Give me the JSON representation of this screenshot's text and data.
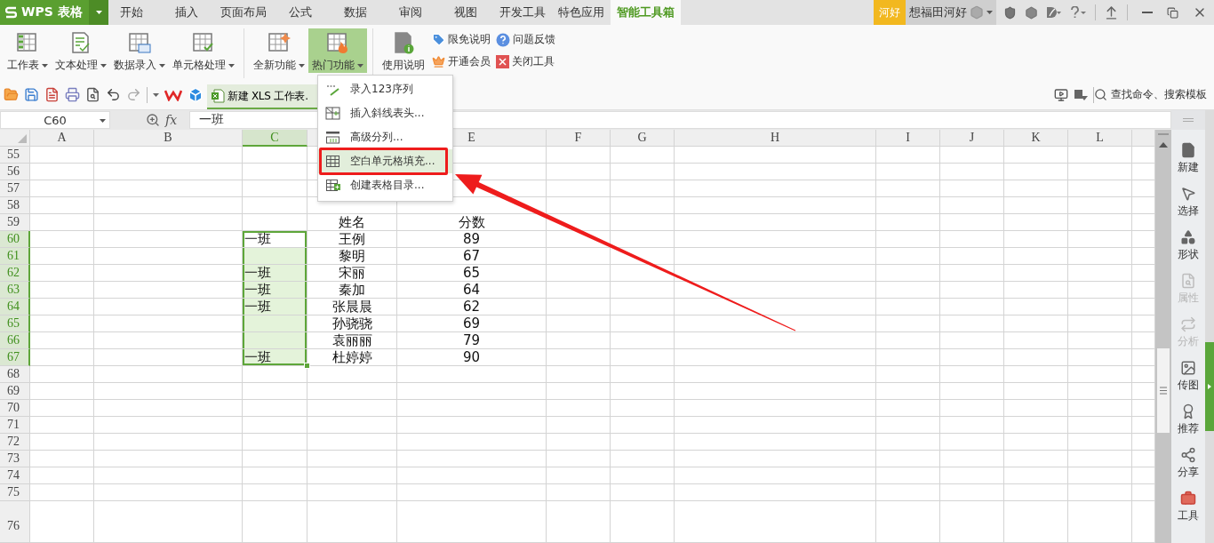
{
  "app": {
    "logo": "WPS 表格"
  },
  "tabs": [
    {
      "label": "开始",
      "selected": false
    },
    {
      "label": "插入",
      "selected": false
    },
    {
      "label": "页面布局",
      "selected": false
    },
    {
      "label": "公式",
      "selected": false
    },
    {
      "label": "数据",
      "selected": false
    },
    {
      "label": "审阅",
      "selected": false
    },
    {
      "label": "视图",
      "selected": false
    },
    {
      "label": "开发工具",
      "selected": false
    },
    {
      "label": "特色应用",
      "selected": false
    },
    {
      "label": "智能工具箱",
      "selected": true
    }
  ],
  "account": {
    "badge": "河好",
    "user": "想福田河好"
  },
  "ribbon": {
    "large_buttons": [
      {
        "label": "工作表",
        "dropdown": true,
        "selected": false
      },
      {
        "label": "文本处理",
        "dropdown": true,
        "selected": false
      },
      {
        "label": "数据录入",
        "dropdown": true,
        "selected": false
      },
      {
        "label": "单元格处理",
        "dropdown": true,
        "selected": false
      },
      {
        "label": "全新功能",
        "dropdown": true,
        "selected": false
      },
      {
        "label": "热门功能",
        "dropdown": true,
        "selected": true
      },
      {
        "label": "使用说明",
        "dropdown": false,
        "selected": false
      }
    ],
    "small_buttons": [
      {
        "label": "限免说明"
      },
      {
        "label": "问题反馈"
      },
      {
        "label": "开通会员"
      },
      {
        "label": "关闭工具"
      }
    ]
  },
  "quick_access": {
    "document_tab": "新建 XLS 工作表.",
    "search": "查找命令、搜索模板"
  },
  "formula_bar": {
    "cell_ref": "C60",
    "function_label": "fx",
    "value": "一班"
  },
  "menu": {
    "items": [
      {
        "label": "录入123序列",
        "selected": false
      },
      {
        "label": "插入斜线表头...",
        "selected": false
      },
      {
        "label": "高级分列...",
        "selected": false
      },
      {
        "label": "空白单元格填充...",
        "selected": true
      },
      {
        "label": "创建表格目录...",
        "selected": false
      }
    ]
  },
  "sheet": {
    "columns": [
      {
        "label": "A",
        "selected": false
      },
      {
        "label": "B",
        "selected": false
      },
      {
        "label": "C",
        "selected": true
      },
      {
        "selected": false
      },
      {
        "label": "E",
        "selected": false
      },
      {
        "label": "F",
        "selected": false
      },
      {
        "label": "G",
        "selected": false
      },
      {
        "label": "H",
        "selected": false
      },
      {
        "label": "I",
        "selected": false
      },
      {
        "label": "J",
        "selected": false
      },
      {
        "label": "K",
        "selected": false
      },
      {
        "label": "L",
        "selected": false
      }
    ],
    "rows": [
      {
        "number": "55",
        "selected": false
      },
      {
        "number": "56",
        "selected": false
      },
      {
        "number": "57",
        "selected": false
      },
      {
        "number": "58",
        "selected": false
      },
      {
        "number": "59",
        "selected": false,
        "column_d": "姓名",
        "column_e": "分数"
      },
      {
        "number": "60",
        "selected": true,
        "column_c": "一班",
        "column_d": "王例",
        "column_e": "89"
      },
      {
        "number": "61",
        "selected": true,
        "column_d": "黎明",
        "column_e": "67"
      },
      {
        "number": "62",
        "selected": true,
        "column_c": "一班",
        "column_d": "宋丽",
        "column_e": "65"
      },
      {
        "number": "63",
        "selected": true,
        "column_c": "一班",
        "column_d": "秦加",
        "column_e": "64"
      },
      {
        "number": "64",
        "selected": true,
        "column_c": "一班",
        "column_d": "张晨晨",
        "column_e": "62"
      },
      {
        "number": "65",
        "selected": true,
        "column_d": "孙骁骁",
        "column_e": "69"
      },
      {
        "number": "66",
        "selected": true,
        "column_d": "袁丽丽",
        "column_e": "79"
      },
      {
        "number": "67",
        "selected": true,
        "column_c": "一班",
        "column_d": "杜婷婷",
        "column_e": "90"
      },
      {
        "number": "68",
        "selected": false
      },
      {
        "number": "69",
        "selected": false
      },
      {
        "number": "70",
        "selected": false
      },
      {
        "number": "71",
        "selected": false
      },
      {
        "number": "72",
        "selected": false
      },
      {
        "number": "73",
        "selected": false
      },
      {
        "number": "74",
        "selected": false
      },
      {
        "number": "75",
        "selected": false
      },
      {
        "number": "76",
        "selected": false
      }
    ]
  },
  "sidebar": {
    "items": [
      {
        "label": "新建",
        "disabled": false
      },
      {
        "label": "选择",
        "disabled": false
      },
      {
        "label": "形状",
        "disabled": false
      },
      {
        "label": "属性",
        "disabled": true
      },
      {
        "label": "分析",
        "disabled": true
      },
      {
        "label": "传图",
        "disabled": false
      },
      {
        "label": "推荐",
        "disabled": false
      },
      {
        "label": "分享",
        "disabled": false
      },
      {
        "label": "工具",
        "disabled": false
      }
    ]
  }
}
